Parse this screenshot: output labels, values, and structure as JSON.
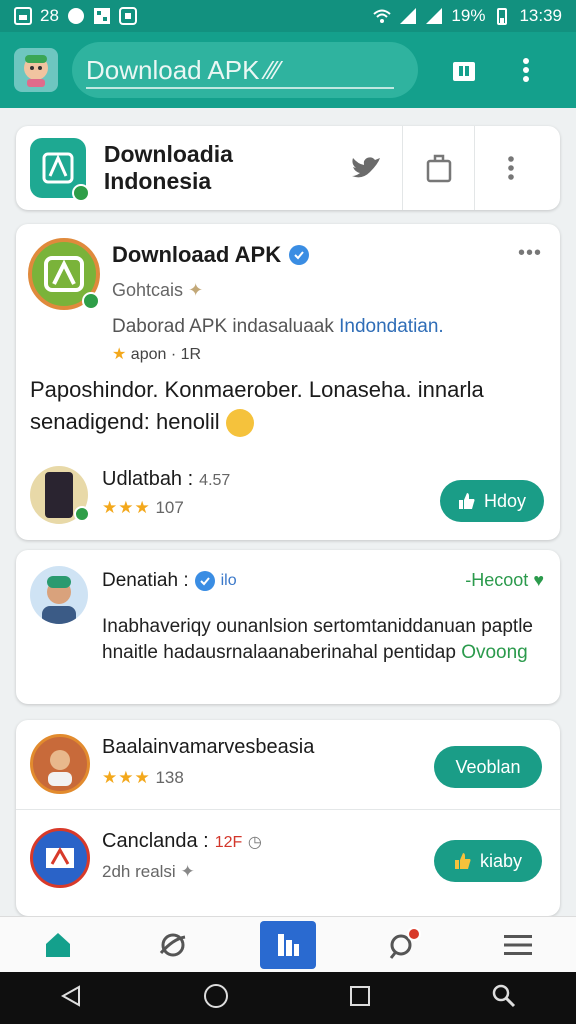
{
  "status_bar": {
    "notif_count": "28",
    "battery": "19%",
    "time": "13:39"
  },
  "appbar": {
    "title": "Download APK  ⁄⁄⁄"
  },
  "profile": {
    "name": "Downloadia Indonesia"
  },
  "post": {
    "title": "Downloaad APK",
    "subtitle": "Gohtcais",
    "desc_main": "Daborad APK indasaluaak ",
    "desc_highlight": "Indondatian.",
    "stars_text": "apon · 1R",
    "body": "Paposhindor. Konmaerober. Lonaseha. innarla senadigend: henolil",
    "app_name": "Udlatbah :",
    "app_version": "4.57",
    "app_rating_stars": "★★★",
    "app_rating_count": "107",
    "action_label": "Hdoy"
  },
  "comment": {
    "author": "Denatiah :",
    "tag": "ilo",
    "follow": "-Hecoot",
    "body": "Inabhaveriqy ounanlsion sertomtaniddanuan paptle hnaitle hadausrnalaanaberinahal pentidap ",
    "body_green": "Ovoong"
  },
  "list": [
    {
      "name": "Baalainvamarvesbeasia",
      "extra": "",
      "stars": "★★★",
      "sub": "138",
      "action": "Veoblan"
    },
    {
      "name": "Canclanda :",
      "extra": "12F",
      "stars": "",
      "sub": "2dh realsi",
      "action": "kiaby"
    }
  ],
  "colors": {
    "primary": "#14a08c",
    "accent": "#1a9d87",
    "star": "#f3a81c",
    "nav_active": "#2a6ad0"
  },
  "icons": {
    "appbar": [
      "app-logo-icon",
      "store-icon",
      "more-vert-icon"
    ],
    "profile": [
      "twitter-icon",
      "share-icon",
      "more-vert-icon"
    ],
    "bottom_nav": [
      "home-icon",
      "explore-icon",
      "apps-icon",
      "messages-icon",
      "menu-icon"
    ],
    "system_nav": [
      "back-icon",
      "home-circle-icon",
      "recents-icon",
      "search-icon"
    ]
  }
}
